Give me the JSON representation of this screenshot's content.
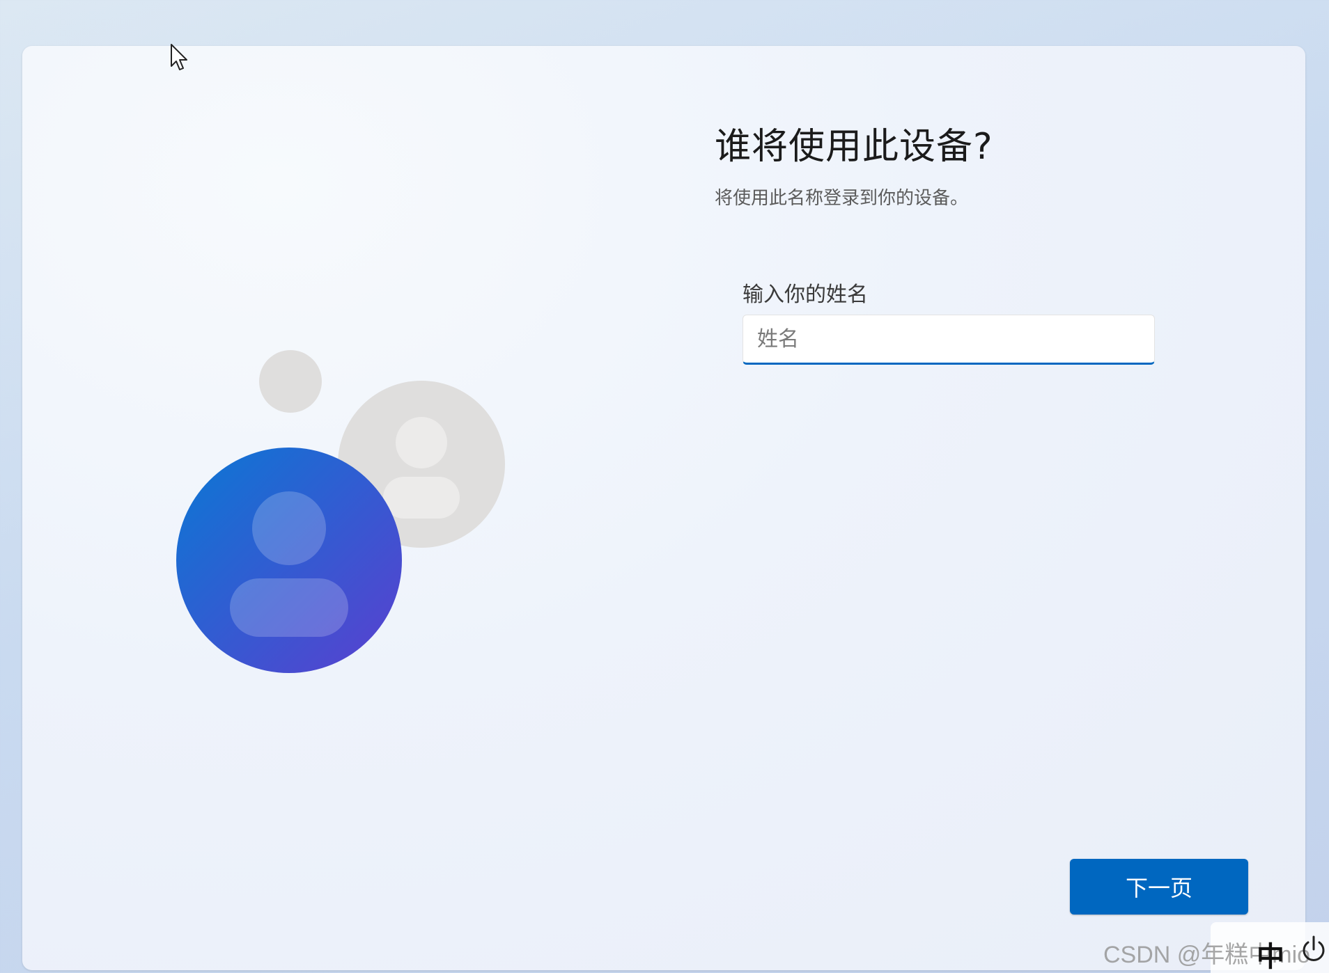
{
  "page": {
    "title": "谁将使用此设备?",
    "subtitle": "将使用此名称登录到你的设备。"
  },
  "form": {
    "name_label": "输入你的姓名",
    "name_placeholder": "姓名",
    "name_value": ""
  },
  "actions": {
    "next_label": "下一页"
  },
  "tray": {
    "ime_indicator": "中",
    "watermark": "CSDN @年糕中mio"
  },
  "colors": {
    "accent": "#0067c0",
    "avatar_gradient_start": "#0a78d4",
    "avatar_gradient_end": "#5b3fcf",
    "avatar_secondary": "#e0dfdf"
  },
  "icons": {
    "cursor": "mouse-pointer-icon",
    "illustration": "user-accounts-illustration",
    "power": "power-icon"
  }
}
